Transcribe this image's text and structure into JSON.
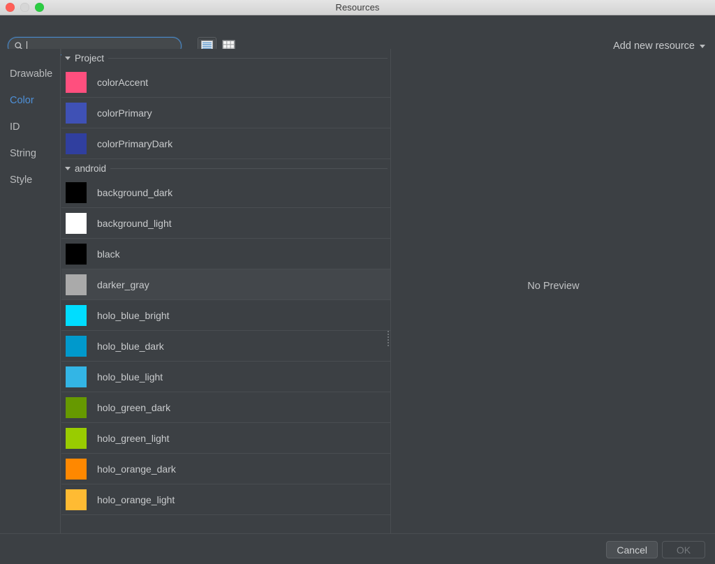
{
  "window": {
    "title": "Resources",
    "traffic_lights": [
      "close-button",
      "minimize-button",
      "maximize-button"
    ]
  },
  "toolbar": {
    "search": {
      "value": "",
      "placeholder": "",
      "icon": "search-icon",
      "focused": true
    },
    "view_toggles": [
      {
        "name": "list-view-toggle",
        "icon": "list-view-icon",
        "selected": true
      },
      {
        "name": "grid-view-toggle",
        "icon": "grid-view-icon",
        "selected": false
      }
    ],
    "add_resource_label": "Add new resource",
    "add_resource_icon": "chevron-down-icon"
  },
  "sidebar": {
    "items": [
      {
        "label": "Drawable",
        "active": false
      },
      {
        "label": "Color",
        "active": true
      },
      {
        "label": "ID",
        "active": false
      },
      {
        "label": "String",
        "active": false
      },
      {
        "label": "Style",
        "active": false
      }
    ],
    "active_color": "#4e90d8"
  },
  "list": {
    "sections": [
      {
        "label": "Project",
        "expanded": true,
        "items": [
          {
            "name": "colorAccent",
            "color": "#ff4f7e",
            "selected": false
          },
          {
            "name": "colorPrimary",
            "color": "#3f51b5",
            "selected": false
          },
          {
            "name": "colorPrimaryDark",
            "color": "#303f9f",
            "selected": false
          }
        ]
      },
      {
        "label": "android",
        "expanded": true,
        "items": [
          {
            "name": "background_dark",
            "color": "#000000",
            "selected": false
          },
          {
            "name": "background_light",
            "color": "#ffffff",
            "selected": false
          },
          {
            "name": "black",
            "color": "#000000",
            "selected": false
          },
          {
            "name": "darker_gray",
            "color": "#aaaaaa",
            "selected": true
          },
          {
            "name": "holo_blue_bright",
            "color": "#00ddff",
            "selected": false
          },
          {
            "name": "holo_blue_dark",
            "color": "#0099cc",
            "selected": false
          },
          {
            "name": "holo_blue_light",
            "color": "#33b5e5",
            "selected": false
          },
          {
            "name": "holo_green_dark",
            "color": "#669900",
            "selected": false
          },
          {
            "name": "holo_green_light",
            "color": "#99cc00",
            "selected": false
          },
          {
            "name": "holo_orange_dark",
            "color": "#ff8800",
            "selected": false
          },
          {
            "name": "holo_orange_light",
            "color": "#ffbb33",
            "selected": false
          }
        ]
      }
    ]
  },
  "preview": {
    "empty_text": "No Preview"
  },
  "footer": {
    "cancel_label": "Cancel",
    "ok_label": "OK",
    "ok_enabled": false
  }
}
